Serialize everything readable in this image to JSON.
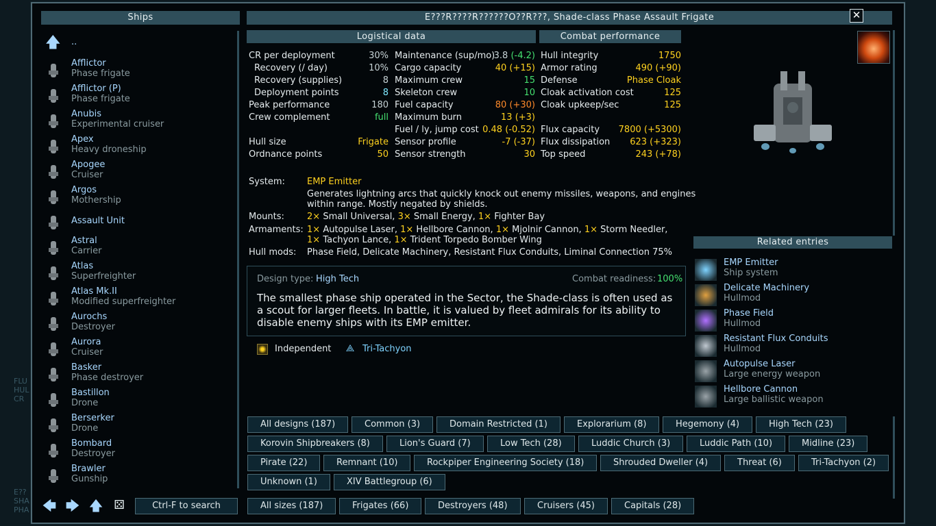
{
  "title": "E???R????R??????O??R???, Shade-class Phase Assault Frigate",
  "ships_header": "Ships",
  "up_label": "..",
  "ships": [
    {
      "name": "Afflictor",
      "type": "Phase frigate"
    },
    {
      "name": "Afflictor (P)",
      "type": "Phase frigate"
    },
    {
      "name": "Anubis",
      "type": "Experimental cruiser"
    },
    {
      "name": "Apex",
      "type": "Heavy droneship"
    },
    {
      "name": "Apogee",
      "type": "Cruiser"
    },
    {
      "name": "Argos",
      "type": "Mothership"
    },
    {
      "name": "Assault Unit",
      "type": ""
    },
    {
      "name": "Astral",
      "type": "Carrier"
    },
    {
      "name": "Atlas",
      "type": "Superfreighter"
    },
    {
      "name": "Atlas Mk.II",
      "type": "Modified superfreighter"
    },
    {
      "name": "Aurochs",
      "type": "Destroyer"
    },
    {
      "name": "Aurora",
      "type": "Cruiser"
    },
    {
      "name": "Basker",
      "type": "Phase destroyer"
    },
    {
      "name": "Bastillon",
      "type": "Drone"
    },
    {
      "name": "Berserker",
      "type": "Drone"
    },
    {
      "name": "Bombard",
      "type": "Destroyer"
    },
    {
      "name": "Brawler",
      "type": "Gunship"
    }
  ],
  "search_label": "Ctrl-F to search",
  "logistics_header": "Logistical data",
  "combat_header": "Combat performance",
  "stats_col1": [
    {
      "label": "CR per deployment",
      "value": "30%",
      "c": ""
    },
    {
      "label": "Recovery (/ day)",
      "value": "10%",
      "c": ""
    },
    {
      "label": "Recovery (supplies)",
      "value": "8",
      "c": ""
    },
    {
      "label": "Deployment points",
      "value": "8",
      "c": "bl"
    },
    {
      "label": "Peak performance",
      "value": "180",
      "c": ""
    },
    {
      "label": "Crew complement",
      "value": "full",
      "c": "gr"
    },
    {
      "label": "",
      "value": "",
      "c": ""
    },
    {
      "label": "Hull size",
      "value": "Frigate",
      "c": "hl"
    },
    {
      "label": "Ordnance points",
      "value": "50",
      "c": "hl"
    }
  ],
  "stats_col2": [
    {
      "label": "Maintenance (sup/mo)",
      "value": "3.8",
      "extra": "(-4.2)",
      "c": ""
    },
    {
      "label": "Cargo capacity",
      "value": "40",
      "extra": "(+15)",
      "c": "hl"
    },
    {
      "label": "Maximum crew",
      "value": "15",
      "extra": "",
      "c": "gr"
    },
    {
      "label": "Skeleton crew",
      "value": "10",
      "extra": "",
      "c": "gr"
    },
    {
      "label": "Fuel capacity",
      "value": "80",
      "extra": "(+30)",
      "c": "or"
    },
    {
      "label": "Maximum burn",
      "value": "13",
      "extra": "(+3)",
      "c": "hl"
    },
    {
      "label": "Fuel / ly, jump cost",
      "value": "0.48",
      "extra": "(-0.52)",
      "c": "hl"
    },
    {
      "label": "Sensor profile",
      "value": "-7",
      "extra": "(-37)",
      "c": "hl"
    },
    {
      "label": "Sensor strength",
      "value": "30",
      "extra": "",
      "c": "hl"
    }
  ],
  "stats_col3": [
    {
      "label": "Hull integrity",
      "value": "1750",
      "c": "hl"
    },
    {
      "label": "Armor rating",
      "value": "490 (+90)",
      "c": "hl"
    },
    {
      "label": "Defense",
      "value": "Phase Cloak",
      "c": "hl"
    },
    {
      "label": "Cloak activation cost",
      "value": "125",
      "c": "hl"
    },
    {
      "label": "Cloak upkeep/sec",
      "value": "125",
      "c": "hl"
    },
    {
      "label": "",
      "value": "",
      "c": ""
    },
    {
      "label": "Flux capacity",
      "value": "7800 (+5300)",
      "c": "hl"
    },
    {
      "label": "Flux dissipation",
      "value": "623 (+323)",
      "c": "hl"
    },
    {
      "label": "Top speed",
      "value": "243 (+78)",
      "c": "hl"
    }
  ],
  "system_label": "System:",
  "system_name": "EMP Emitter",
  "system_desc_1": "Generates lightning arcs that quickly knock out enemy missiles, weapons, and engines",
  "system_desc_2": "within range. Mostly negated by shields.",
  "mounts_label": "Mounts:",
  "mounts": [
    {
      "n": "2×",
      "t": "Small Universal,"
    },
    {
      "n": "3×",
      "t": "Small Energy,"
    },
    {
      "n": "1×",
      "t": "Fighter Bay"
    }
  ],
  "armaments_label": "Armaments:",
  "armaments_1": [
    {
      "n": "1×",
      "t": "Autopulse Laser,"
    },
    {
      "n": "1×",
      "t": "Hellbore Cannon,"
    },
    {
      "n": "1×",
      "t": "Mjolnir Cannon,"
    },
    {
      "n": "1×",
      "t": "Storm Needler,"
    }
  ],
  "armaments_2": [
    {
      "n": "1×",
      "t": "Tachyon Lance,"
    },
    {
      "n": "1×",
      "t": "Trident Torpedo Bomber Wing"
    }
  ],
  "hullmods_label": "Hull mods:",
  "hullmods": "Phase Field, Delicate Machinery, Resistant Flux Conduits, Liminal Connection 75%",
  "design_type_label": "Design type:",
  "design_type": "High Tech",
  "cr_label": "Combat readiness:",
  "cr_value": "100%",
  "description": "The smallest phase ship operated in the Sector, the Shade-class is often used as a scout for larger fleets. In battle, it is valued by fleet admirals for its ability to disable enemy ships with its EMP emitter.",
  "factions": [
    {
      "name": "Independent",
      "c": "#d8e0e2"
    },
    {
      "name": "Tri-Tachyon",
      "c": "#7fd3ff"
    }
  ],
  "related_header": "Related entries",
  "related": [
    {
      "name": "EMP Emitter",
      "type": "Ship system"
    },
    {
      "name": "Delicate Machinery",
      "type": "Hullmod"
    },
    {
      "name": "Phase Field",
      "type": "Hullmod"
    },
    {
      "name": "Resistant Flux Conduits",
      "type": "Hullmod"
    },
    {
      "name": "Autopulse Laser",
      "type": "Large energy weapon"
    },
    {
      "name": "Hellbore Cannon",
      "type": "Large ballistic weapon"
    }
  ],
  "filters": [
    "All designs (187)",
    "Common (3)",
    "Domain Restricted (1)",
    "Explorarium (8)",
    "Hegemony (4)",
    "High Tech (23)",
    "Korovin Shipbreakers (8)",
    "Lion's Guard (7)",
    "Low Tech (28)",
    "Luddic Church (3)",
    "Luddic Path (10)",
    "Midline (23)",
    "Pirate (22)",
    "Remnant (10)",
    "Rockpiper Engineering Society (18)",
    "Shrouded Dweller (4)",
    "Threat (6)",
    "Tri-Tachyon (2)",
    "Unknown (1)",
    "XIV Battlegroup (6)"
  ],
  "sizes": [
    "All sizes (187)",
    "Frigates (66)",
    "Destroyers (48)",
    "Cruisers (45)",
    "Capitals (28)"
  ],
  "colors": {
    "panel": "#2f4e5a",
    "highlight": "#ffd21f",
    "link": "#a9d8ff",
    "good": "#45e070",
    "cyan": "#7fe8ff"
  }
}
